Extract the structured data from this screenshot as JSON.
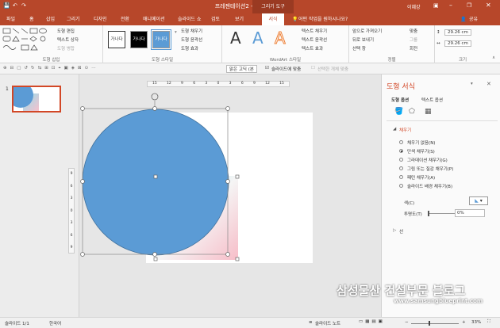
{
  "app": {
    "title": "프레젠테이션2 - PowerPoint",
    "context_group": "그리기 도구",
    "user": "이혜강"
  },
  "tabs": [
    "파일",
    "홈",
    "삽입",
    "그리기",
    "디자인",
    "전환",
    "애니메이션",
    "슬라이드 쇼",
    "검토",
    "보기",
    "서식"
  ],
  "tell_me": "어떤 작업을 원하시나요?",
  "share": "공유",
  "ribbon": {
    "insert_shapes": {
      "label": "도형 삽입",
      "edit_shape": "도형 편집",
      "text_box": "텍스트 상자",
      "merge_shapes": "도형 병합"
    },
    "shape_styles": {
      "label": "도형 스타일",
      "swatch_text": "가나다",
      "fill": "도형 채우기",
      "outline": "도형 윤곽선",
      "effects": "도형 효과"
    },
    "wordart": {
      "label": "WordArt 스타일",
      "letter": "A",
      "text_fill": "텍스트 채우기",
      "text_outline": "텍스트 윤곽선",
      "text_effects": "텍스트 효과"
    },
    "arrange": {
      "label": "정렬",
      "bring_forward": "앞으로 가져오기",
      "send_backward": "뒤로 보내기",
      "selection_pane": "선택 창",
      "align": "맞춤",
      "group": "그룹",
      "rotate": "회전"
    },
    "size": {
      "label": "크기",
      "height": "29.26 cm",
      "width": "29.26 cm"
    }
  },
  "qat": {
    "font": "맑은 고딕 (본",
    "snap": "슬라이드에 맞춤",
    "snap2": "선택한 개체 맞춤"
  },
  "thumb": {
    "number": "1"
  },
  "ruler": {
    "h": [
      "15",
      "12",
      "9",
      "6",
      "3",
      "0",
      "3",
      "6",
      "9",
      "12",
      "15"
    ],
    "v": [
      "9",
      "6",
      "3",
      "0",
      "3",
      "6",
      "9"
    ]
  },
  "pane": {
    "title": "도형 서식",
    "tab_shape": "도형 옵션",
    "tab_text": "텍스트 옵션",
    "fill_section": "채우기",
    "options": [
      "채우기 없음(N)",
      "단색 채우기(S)",
      "그라데이션 채우기(G)",
      "그림 또는 질감 채우기(P)",
      "패턴 채우기(A)",
      "슬라이드 배경 채우기(B)"
    ],
    "selected_option": 1,
    "color_label": "색(C)",
    "transparency_label": "투명도(T)",
    "transparency_value": "0%",
    "line_section": "선"
  },
  "status": {
    "slide": "슬라이드 1/1",
    "lang": "한국어",
    "notes": "슬라이드 노트",
    "zoom": "33%"
  },
  "watermark": {
    "title": "삼성물산 건설부문 블로그",
    "url": "www.samsungblueprint.com"
  },
  "colors": {
    "accent": "#b7472a",
    "circle": "#5b9bd5",
    "pane_title": "#d24726"
  }
}
